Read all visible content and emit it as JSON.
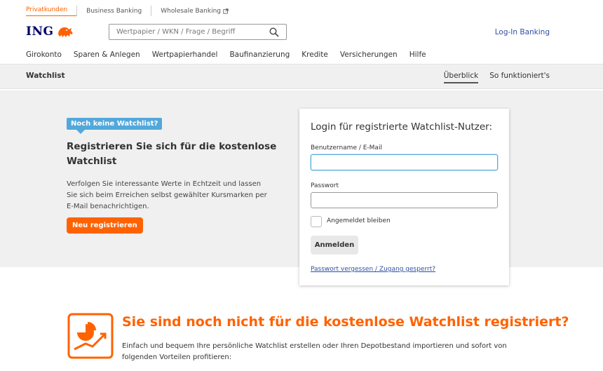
{
  "topnav": {
    "items": [
      {
        "label": "Privatkunden",
        "active": true
      },
      {
        "label": "Business Banking",
        "active": false
      },
      {
        "label": "Wholesale Banking",
        "active": false,
        "external": true
      }
    ]
  },
  "header": {
    "logo_text": "ING",
    "search_placeholder": "Wertpapier / WKN / Frage / Begriff",
    "login_link": "Log-In Banking"
  },
  "mainmenu": {
    "items": [
      "Girokonto",
      "Sparen & Anlegen",
      "Wertpapierhandel",
      "Baufinanzierung",
      "Kredite",
      "Versicherungen",
      "Hilfe"
    ]
  },
  "subbar": {
    "title": "Watchlist",
    "tabs": [
      {
        "label": "Überblick",
        "active": true
      },
      {
        "label": "So funktioniert's",
        "active": false
      }
    ]
  },
  "hero": {
    "badge": "Noch keine Watchlist?",
    "heading": "Registrieren Sie sich für die kostenlose Watchlist",
    "text": "Verfolgen Sie interessante Werte in Echtzeit und lassen Sie sich beim Erreichen selbst gewählter Kursmarken per E-Mail benachrichtigen.",
    "register_button": "Neu registrieren"
  },
  "login": {
    "title": "Login für registrierte Watchlist-Nutzer:",
    "username_label": "Benutzername / E-Mail",
    "username_value": "",
    "password_label": "Passwort",
    "password_value": "",
    "remember_label": "Angemeldet bleiben",
    "remember_checked": false,
    "submit_button": "Anmelden",
    "forgot_link": "Passwort vergessen / Zugang gesperrt?"
  },
  "promo": {
    "title": "Sie sind noch nicht für die kostenlose Watchlist registriert?",
    "text": "Einfach und bequem Ihre persönliche Watchlist erstellen oder Ihren Depotbestand importieren und sofort von folgenden Vorteilen profitieren:"
  },
  "colors": {
    "brand_orange": "#ff6200",
    "brand_blue": "#000066",
    "badge_blue": "#52a8db",
    "link_blue": "#2d4fa3"
  },
  "icons": [
    "external-link-icon",
    "lion-logo-icon",
    "search-icon",
    "chart-promo-icon"
  ]
}
